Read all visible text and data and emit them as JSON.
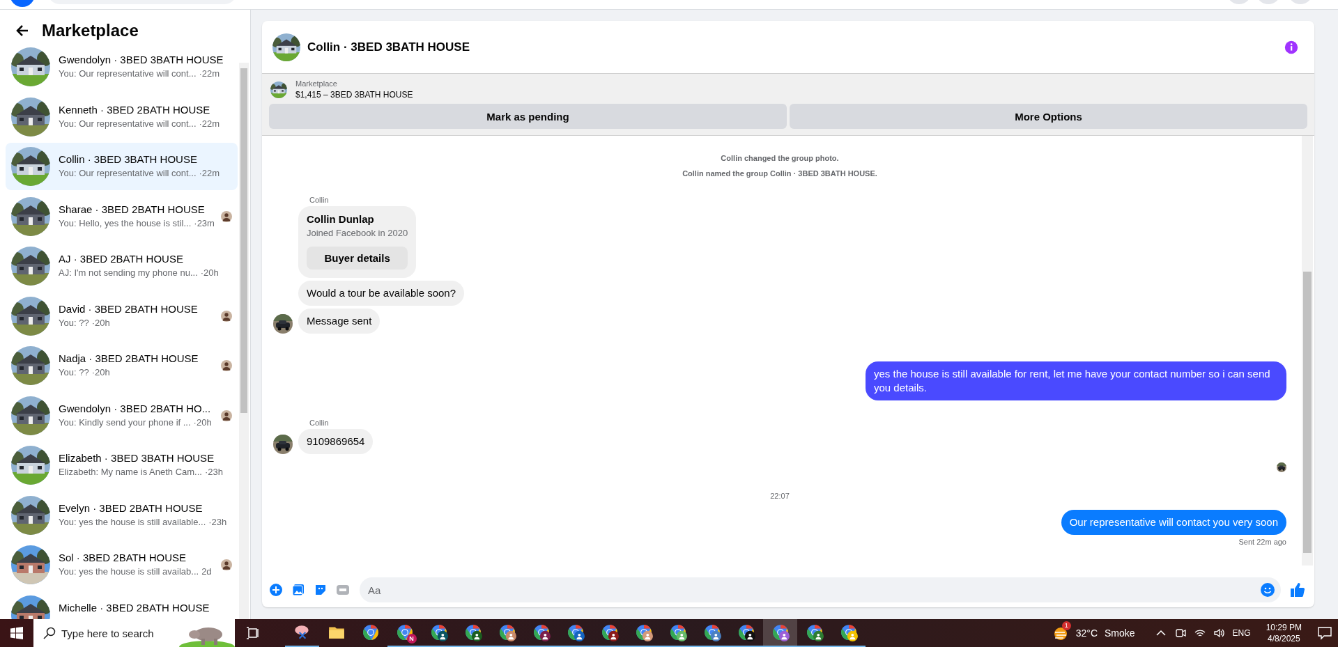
{
  "sidebar": {
    "title": "Marketplace",
    "conversations": [
      {
        "name": "Gwendolyn · 3BED 3BATH HOUSE",
        "preview": "You: Our representative will cont...",
        "time": "·22m",
        "selected": false,
        "read_receipt": false
      },
      {
        "name": "Kenneth · 3BED 2BATH HOUSE",
        "preview": "You: Our representative will cont...",
        "time": "·22m",
        "selected": false,
        "read_receipt": false
      },
      {
        "name": "Collin · 3BED 3BATH HOUSE",
        "preview": "You: Our representative will cont...",
        "time": "·22m",
        "selected": true,
        "read_receipt": false
      },
      {
        "name": "Sharae · 3BED 2BATH HOUSE",
        "preview": "You: Hello, yes the house is stil...",
        "time": "·23m",
        "selected": false,
        "read_receipt": true
      },
      {
        "name": "AJ · 3BED 2BATH HOUSE",
        "preview": "AJ: I'm not sending my phone nu...",
        "time": "·20h",
        "selected": false,
        "read_receipt": false
      },
      {
        "name": "David · 3BED 2BATH HOUSE",
        "preview": "You: ??",
        "time": "·20h",
        "selected": false,
        "read_receipt": true
      },
      {
        "name": "Nadja · 3BED 2BATH HOUSE",
        "preview": "You: ??",
        "time": "·20h",
        "selected": false,
        "read_receipt": true
      },
      {
        "name": "Gwendolyn · 3BED 2BATH HO...",
        "preview": "You: Kindly send your phone if ...",
        "time": "·20h",
        "selected": false,
        "read_receipt": true
      },
      {
        "name": "Elizabeth · 3BED 3BATH HOUSE",
        "preview": "Elizabeth: My name is Aneth Cam...",
        "time": "·23h",
        "selected": false,
        "read_receipt": false
      },
      {
        "name": "Evelyn · 3BED 2BATH HOUSE",
        "preview": "You: yes the house is still available...",
        "time": "·23h",
        "selected": false,
        "read_receipt": false
      },
      {
        "name": "Sol · 3BED 2BATH HOUSE",
        "preview": "You: yes the house is still availab...",
        "time": "2d",
        "selected": false,
        "read_receipt": true
      },
      {
        "name": "Michelle · 3BED 2BATH HOUSE",
        "selected": false,
        "read_receipt": false
      }
    ]
  },
  "chat": {
    "title": "Collin · 3BED 3BATH HOUSE",
    "listing": {
      "source": "Marketplace",
      "summary": "$1,415 – 3BED 3BATH HOUSE"
    },
    "actions": [
      "Mark as pending",
      "More Options"
    ],
    "messages": [
      {
        "kind": "system",
        "text": "Collin changed the group photo."
      },
      {
        "kind": "system",
        "text": "Collin named the group Collin · 3BED 3BATH HOUSE."
      },
      {
        "kind": "sender",
        "text": "Collin"
      },
      {
        "kind": "profile",
        "name": "Collin Dunlap",
        "detail": "Joined Facebook in 2020",
        "button": "Buyer details"
      },
      {
        "kind": "incoming",
        "text": "Would a tour be available soon?",
        "avatar": false
      },
      {
        "kind": "incoming",
        "text": "Message sent",
        "avatar": true
      },
      {
        "kind": "outgoing",
        "text": "yes the house is still available for rent, let me have your contact number so i can send you details.",
        "color": "#4a4aff"
      },
      {
        "kind": "sender",
        "text": "Collin"
      },
      {
        "kind": "incoming",
        "text": "9109869654",
        "avatar": true
      },
      {
        "kind": "receipt"
      },
      {
        "kind": "timestamp",
        "text": "22:07"
      },
      {
        "kind": "outgoing",
        "text": "Our representative will contact you very soon",
        "color": "#0a7cff"
      },
      {
        "kind": "status",
        "text": "Sent 22m ago"
      }
    ],
    "composer": {
      "placeholder": "Aa"
    }
  },
  "taskbar": {
    "search_placeholder": "Type here to search",
    "apps": [
      {
        "kind": "snip",
        "running": true,
        "selected": false
      },
      {
        "kind": "folder",
        "running": false,
        "selected": false
      },
      {
        "kind": "chrome",
        "running": false,
        "selected": false
      },
      {
        "kind": "chrome-letter",
        "badge": "N",
        "color": "#c2185b",
        "running": true,
        "selected": false
      },
      {
        "kind": "chrome-profile",
        "color": "#0b5563",
        "running": true,
        "selected": false
      },
      {
        "kind": "chrome-profile",
        "color": "#1b5e20",
        "running": true,
        "selected": false
      },
      {
        "kind": "chrome-profile",
        "color": "#c98a6a",
        "running": true,
        "selected": false
      },
      {
        "kind": "chrome-profile",
        "color": "#7b1f4a",
        "running": true,
        "selected": false
      },
      {
        "kind": "chrome-profile",
        "color": "#1565c0",
        "running": true,
        "selected": false
      },
      {
        "kind": "chrome-profile",
        "color": "#8b1a1a",
        "running": true,
        "selected": false
      },
      {
        "kind": "chrome-profile",
        "color": "#d49a7a",
        "running": true,
        "selected": false
      },
      {
        "kind": "chrome-profile",
        "color": "#66bb6a",
        "running": true,
        "selected": false
      },
      {
        "kind": "chrome-profile",
        "color": "#4a7fc1",
        "running": true,
        "selected": false
      },
      {
        "kind": "chrome-profile",
        "color": "#111111",
        "running": true,
        "selected": false
      },
      {
        "kind": "chrome-profile",
        "color": "#9c5fd6",
        "running": true,
        "selected": true
      },
      {
        "kind": "chrome-profile",
        "color": "#2e7d32",
        "running": true,
        "selected": false
      },
      {
        "kind": "chrome-profile",
        "color": "#f2c200",
        "running": true,
        "selected": false
      }
    ],
    "weather": {
      "badge": "1",
      "temperature": "32°C",
      "condition": "Smoke"
    },
    "language": "ENG",
    "time": "10:29 PM",
    "date": "4/8/2025"
  }
}
